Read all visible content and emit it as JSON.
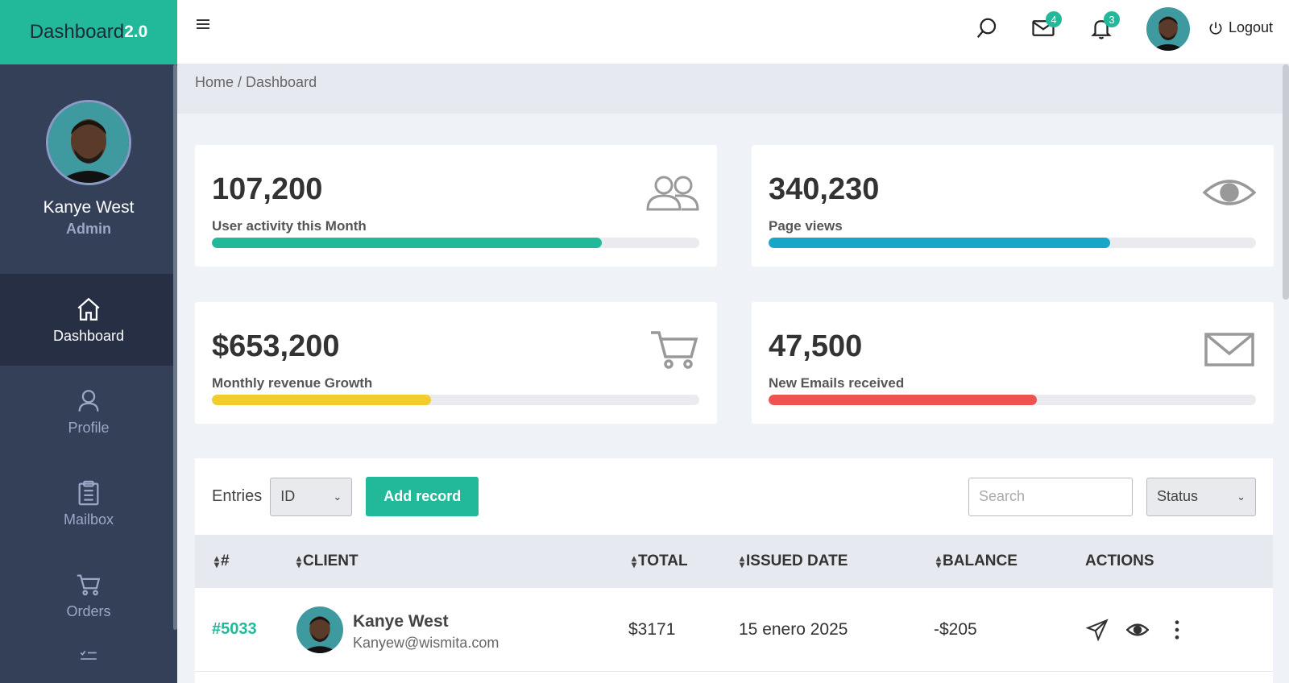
{
  "brand": {
    "name": "Dashboard",
    "version": "2.0"
  },
  "user": {
    "name": "Kanye West",
    "role": "Admin"
  },
  "sidebar": {
    "items": [
      {
        "label": "Dashboard",
        "icon": "home-icon",
        "active": true
      },
      {
        "label": "Profile",
        "icon": "user-icon",
        "active": false
      },
      {
        "label": "Mailbox",
        "icon": "clipboard-icon",
        "active": false
      },
      {
        "label": "Orders",
        "icon": "cart-icon",
        "active": false
      }
    ]
  },
  "topbar": {
    "mail_count": "4",
    "notification_count": "3",
    "logout_label": "Logout"
  },
  "breadcrumb": "Home / Dashboard",
  "stats": [
    {
      "value": "107,200",
      "label": "User activity this Month",
      "progress": 0.8,
      "color": "#22b99a",
      "icon": "users-icon"
    },
    {
      "value": "340,230",
      "label": "Page views",
      "progress": 0.7,
      "color": "#18a6c8",
      "icon": "eye-icon"
    },
    {
      "value": "$653,200",
      "label": "Monthly revenue Growth",
      "progress": 0.45,
      "color": "#f2cb2c",
      "icon": "cart-icon"
    },
    {
      "value": "47,500",
      "label": "New Emails received",
      "progress": 0.55,
      "color": "#ef5350",
      "icon": "envelope-icon"
    }
  ],
  "table": {
    "entries_label": "Entries",
    "entries_select": "ID",
    "add_button": "Add record",
    "search_placeholder": "Search",
    "status_select": "Status",
    "columns": [
      "#",
      "CLIENT",
      "TOTAL",
      "ISSUED DATE",
      "BALANCE",
      "ACTIONS"
    ],
    "rows": [
      {
        "id": "#5033",
        "client_name": "Kanye West",
        "client_email": "Kanyew@wismita.com",
        "total": "$3171",
        "issued_date": "15 enero 2025",
        "balance": "-$205"
      }
    ]
  }
}
